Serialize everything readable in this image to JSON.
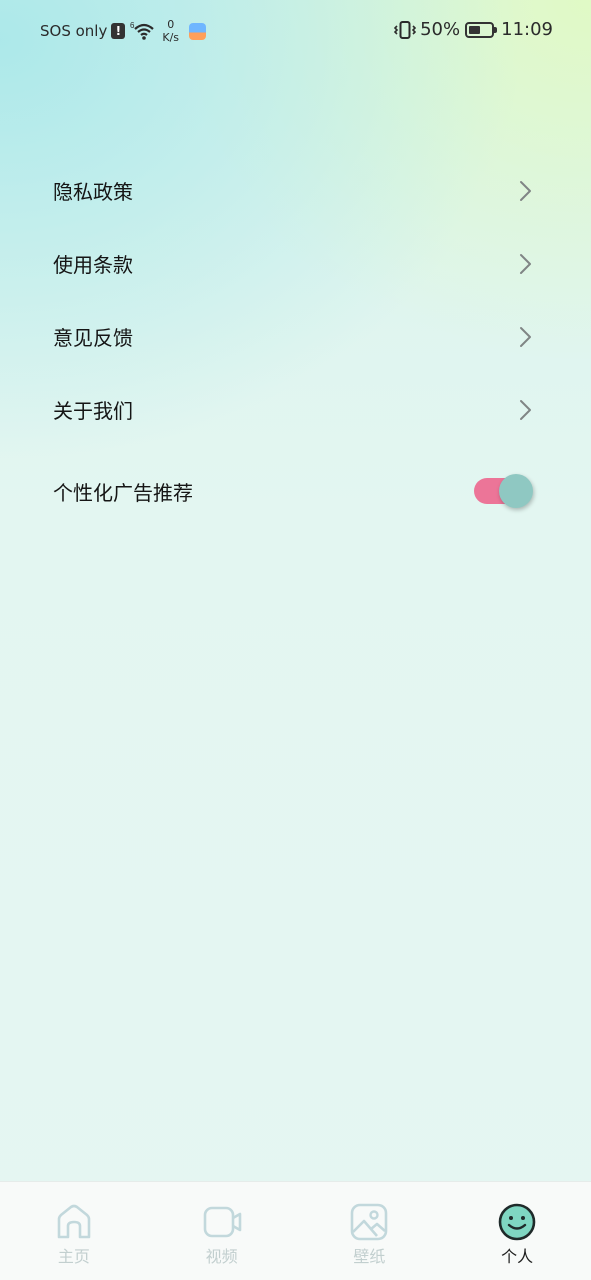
{
  "status_bar": {
    "carrier": "SOS only",
    "network_speed_value": "0",
    "network_speed_unit": "K/s",
    "signal_badge": "6",
    "battery_percent": "50%",
    "battery_level": 0.5,
    "time": "11:09",
    "icons": [
      "alert-icon",
      "wifi-icon",
      "app-notification-icon",
      "vibrate-icon",
      "battery-icon"
    ]
  },
  "menu": {
    "items": [
      {
        "label": "隐私政策",
        "icon": "chevron-right-icon"
      },
      {
        "label": "使用条款",
        "icon": "chevron-right-icon"
      },
      {
        "label": "意见反馈",
        "icon": "chevron-right-icon"
      },
      {
        "label": "关于我们",
        "icon": "chevron-right-icon"
      }
    ],
    "ad_toggle": {
      "label": "个性化广告推荐",
      "enabled": true
    }
  },
  "bottom_nav": {
    "items": [
      {
        "label": "主页",
        "icon": "home-icon",
        "active": false
      },
      {
        "label": "视频",
        "icon": "video-icon",
        "active": false
      },
      {
        "label": "壁纸",
        "icon": "wallpaper-icon",
        "active": false
      },
      {
        "label": "个人",
        "icon": "profile-smiley-icon",
        "active": true
      }
    ]
  },
  "colors": {
    "toggle_track": "#ec7598",
    "toggle_knob": "#8fc8c2",
    "nav_inactive": "#c2cfcf",
    "nav_active_icon": "#7fd6c2",
    "text_primary": "#151515"
  }
}
